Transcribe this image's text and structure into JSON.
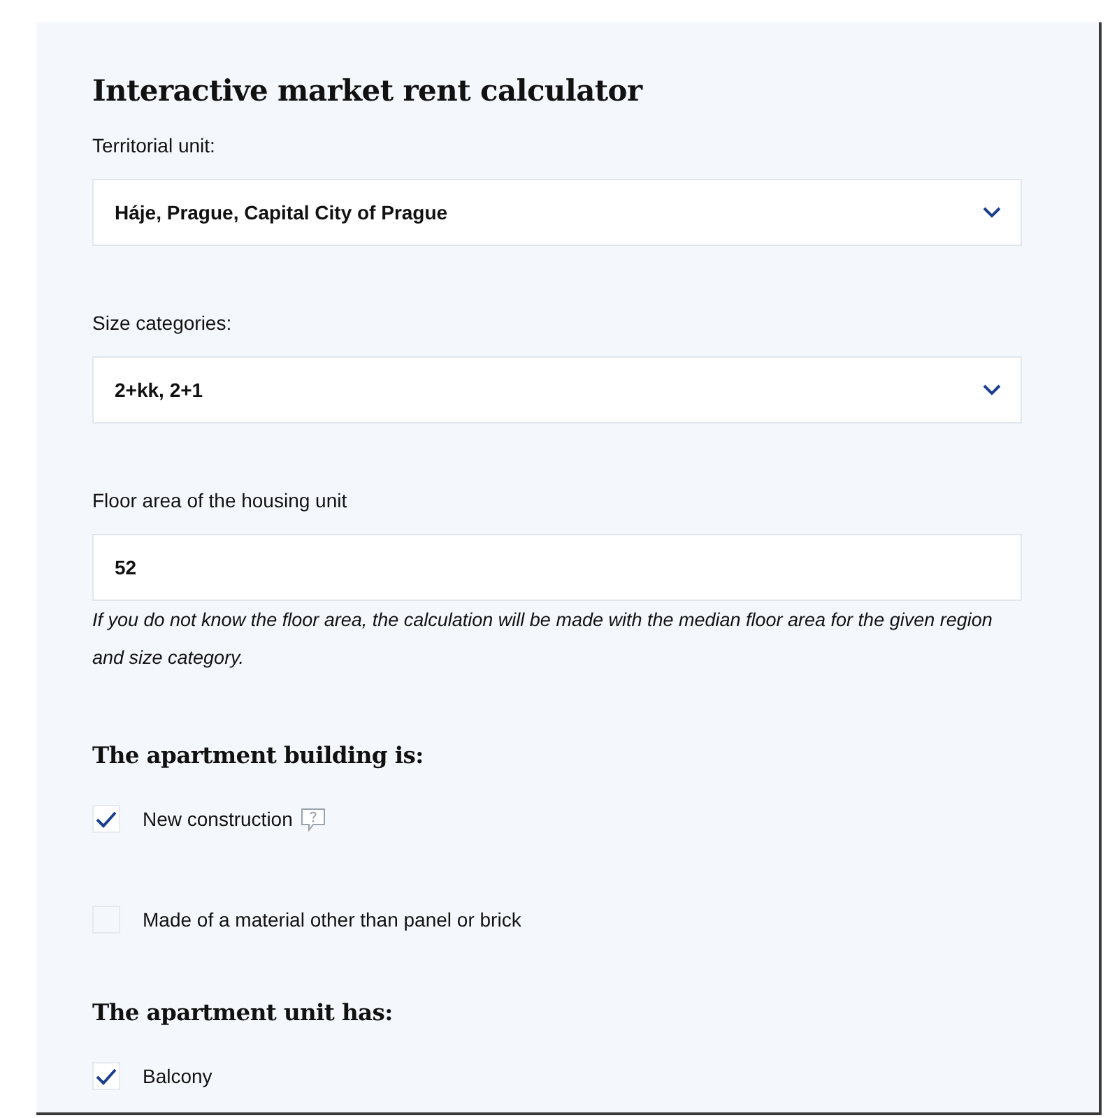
{
  "title": "Interactive market rent calculator",
  "fields": [
    {
      "kind": "select",
      "label": "Territorial unit:",
      "value": "Háje, Prague, Capital City of Prague"
    },
    {
      "kind": "select",
      "label": "Size categories:",
      "value": "2+kk, 2+1"
    },
    {
      "kind": "text",
      "label": "Floor area of the housing unit",
      "value": "52",
      "note": "If you do not know the floor area, the calculation will be made with the median floor area for the given region and size category."
    }
  ],
  "sections": [
    {
      "heading": "The apartment building is:",
      "options": [
        {
          "label": "New construction",
          "checked": true,
          "help": true
        },
        {
          "label": "Made of a material other than panel or brick",
          "checked": false,
          "help": false
        }
      ]
    },
    {
      "heading": "The apartment unit has:",
      "options": [
        {
          "label": "Balcony",
          "checked": true,
          "help": false
        }
      ]
    }
  ]
}
